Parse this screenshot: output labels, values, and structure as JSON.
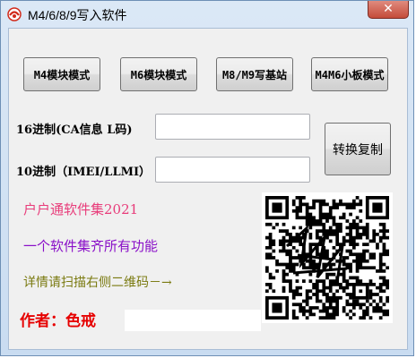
{
  "window": {
    "title": "M4/6/8/9写入软件",
    "close_label": "✕"
  },
  "buttons": {
    "m4": "M4模块模式",
    "m6": "M6模块模式",
    "m8m9": "M8/M9写基站",
    "m4m6": "M4M6小板模式",
    "convert": "转换复制"
  },
  "fields": {
    "hex_label": "16进制(CA信息 L码)",
    "hex_value": "",
    "dec_label": "10进制（IMEI/LLMI）",
    "dec_value": ""
  },
  "promo": {
    "line1": "户户通软件集2021",
    "line2": "一个软件集齐所有功能",
    "line3": "详情请扫描右侧二维码－→",
    "author": "作者：色戒",
    "author_value": ""
  },
  "colors": {
    "line1": "#e83c7a",
    "line2": "#8a10c8",
    "line3": "#7a7a10",
    "author": "#e60000"
  },
  "icons": {
    "app": "app-logo-icon",
    "qr": "qr-code-icon",
    "close": "close-icon"
  }
}
